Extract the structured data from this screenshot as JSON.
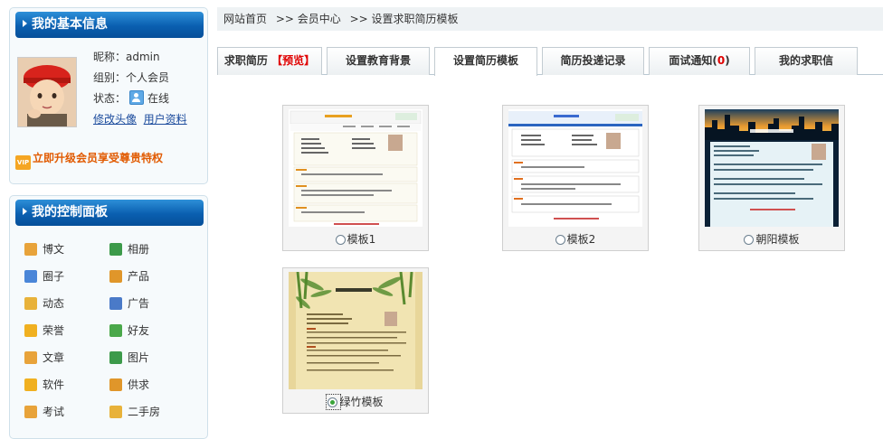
{
  "profile_panel": {
    "title": "我的基本信息",
    "nickname": "昵称：admin",
    "group": "组别：个人会员",
    "status_label": "状态：",
    "status_value": "在线",
    "link_avatar": "修改头像",
    "link_profile": "用户资料",
    "upgrade": "立即升级会员享受尊贵特权",
    "vip_badge": "VIP"
  },
  "control_panel": {
    "title": "我的控制面板",
    "items": [
      {
        "label": "博文",
        "icon": "blog-icon",
        "color": "#e8a33a"
      },
      {
        "label": "相册",
        "icon": "album-icon",
        "color": "#3c9a4a"
      },
      {
        "label": "圈子",
        "icon": "circle-icon",
        "color": "#4a86d8"
      },
      {
        "label": "产品",
        "icon": "product-icon",
        "color": "#e0962a"
      },
      {
        "label": "动态",
        "icon": "news-icon",
        "color": "#e8b23a"
      },
      {
        "label": "广告",
        "icon": "ad-icon",
        "color": "#4a7ac8"
      },
      {
        "label": "荣誉",
        "icon": "honor-icon",
        "color": "#f0b020"
      },
      {
        "label": "好友",
        "icon": "friend-icon",
        "color": "#4aa84a"
      },
      {
        "label": "文章",
        "icon": "article-icon",
        "color": "#e8a33a"
      },
      {
        "label": "图片",
        "icon": "picture-icon",
        "color": "#3c9a4a"
      },
      {
        "label": "软件",
        "icon": "software-icon",
        "color": "#f0b020"
      },
      {
        "label": "供求",
        "icon": "supply-icon",
        "color": "#e0962a"
      },
      {
        "label": "考试",
        "icon": "exam-icon",
        "color": "#e8a33a"
      },
      {
        "label": "二手房",
        "icon": "house-icon",
        "color": "#e8b23a"
      }
    ]
  },
  "breadcrumb": {
    "home": "网站首页",
    "member": ">> 会员中心",
    "current": ">> 设置求职简历模板"
  },
  "tabs": [
    {
      "label": "求职简历",
      "extra": "【预览】"
    },
    {
      "label": "设置教育背景"
    },
    {
      "label": "设置简历模板",
      "active": true
    },
    {
      "label": "简历投递记录"
    },
    {
      "label": "面试通知",
      "extra_open": "(",
      "extra": "0",
      "extra_close": ")"
    },
    {
      "label": "我的求职信"
    }
  ],
  "templates": [
    {
      "label": "模板1",
      "selected": false,
      "style": "template-1-thumbnail"
    },
    {
      "label": "模板2",
      "selected": false,
      "style": "template-2-thumbnail"
    },
    {
      "label": "朝阳模板",
      "selected": false,
      "style": "sunrise-template-thumbnail"
    },
    {
      "label": "绿竹模板",
      "selected": true,
      "style": "bamboo-template-thumbnail"
    }
  ]
}
